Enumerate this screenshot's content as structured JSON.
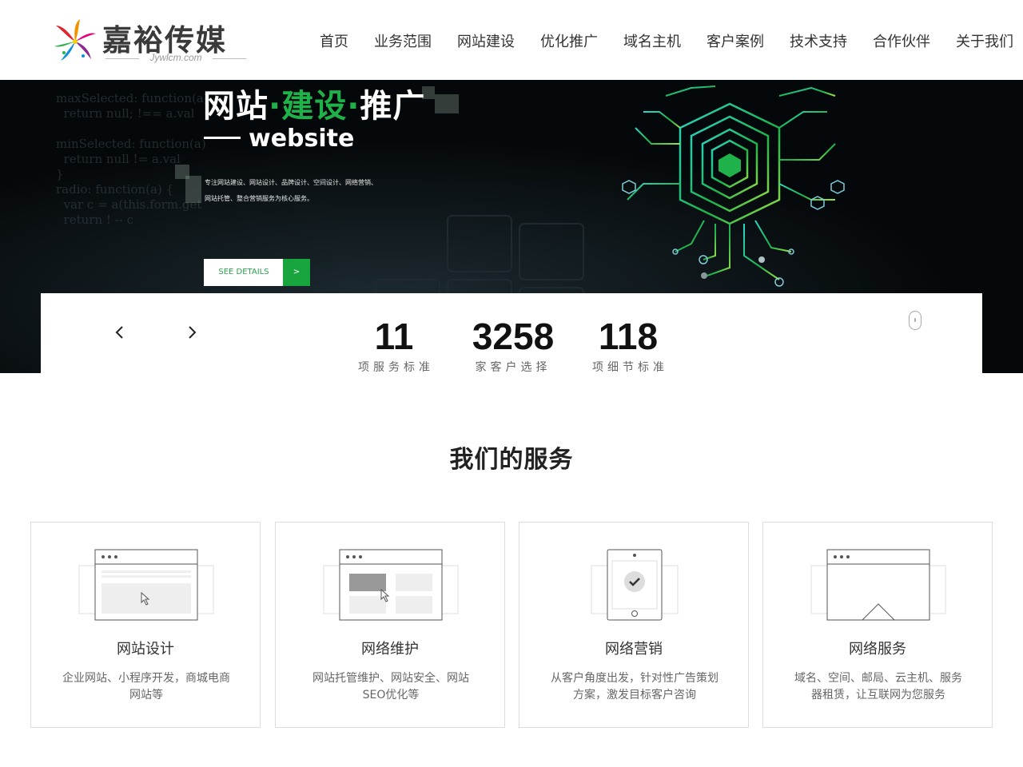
{
  "header": {
    "logo_text": "嘉裕传媒",
    "logo_sub": "Jywlcm.com",
    "nav": [
      "首页",
      "业务范围",
      "网站建设",
      "优化推广",
      "域名主机",
      "客户案例",
      "技术支持",
      "合作伙伴",
      "关于我们"
    ]
  },
  "banner": {
    "title_1": "网站",
    "title_dot_1": "·",
    "title_2": "建设",
    "title_dot_2": "·",
    "title_3": "推广",
    "subtitle": "website",
    "desc_line_1": "专注网站建设、网站设计、品牌设计、空间设计、网络营销、",
    "desc_line_2": "网站托管、整合营销服务为核心服务。",
    "button_label": "SEE DETAILS",
    "button_arrow": ">",
    "code_text": "maxSelected: function(a) {\n  return null; !== a.val\n\nminSelected: function(a)\n  return null != a.val\n}\nradio: function(a) {\n  var c = a(this.form.get\n  return ! -- c"
  },
  "stats": [
    {
      "value": "11",
      "label": "项服务标准"
    },
    {
      "value": "3258",
      "label": "家客户选择"
    },
    {
      "value": "118",
      "label": "项细节标准"
    }
  ],
  "services": {
    "title": "我们的服务",
    "cards": [
      {
        "title": "网站设计",
        "desc": "企业网站、小程序开发，商城电商网站等"
      },
      {
        "title": "网络维护",
        "desc": "网站托管维护、网站安全、网站SEO优化等"
      },
      {
        "title": "网络营销",
        "desc": "从客户角度出发，针对性广告策划方案，激发目标客户咨询"
      },
      {
        "title": "网络服务",
        "desc": "域名、空间、邮局、云主机、服务器租赁，让互联网为您服务"
      }
    ]
  },
  "colors": {
    "accent_green": "#19a53d",
    "banner_bg": "#05080a"
  },
  "icons": [
    "logo-pinwheel-icon",
    "chevron-left-icon",
    "chevron-right-icon",
    "mouse-scroll-icon",
    "browser-window-icon",
    "tablet-check-icon"
  ]
}
